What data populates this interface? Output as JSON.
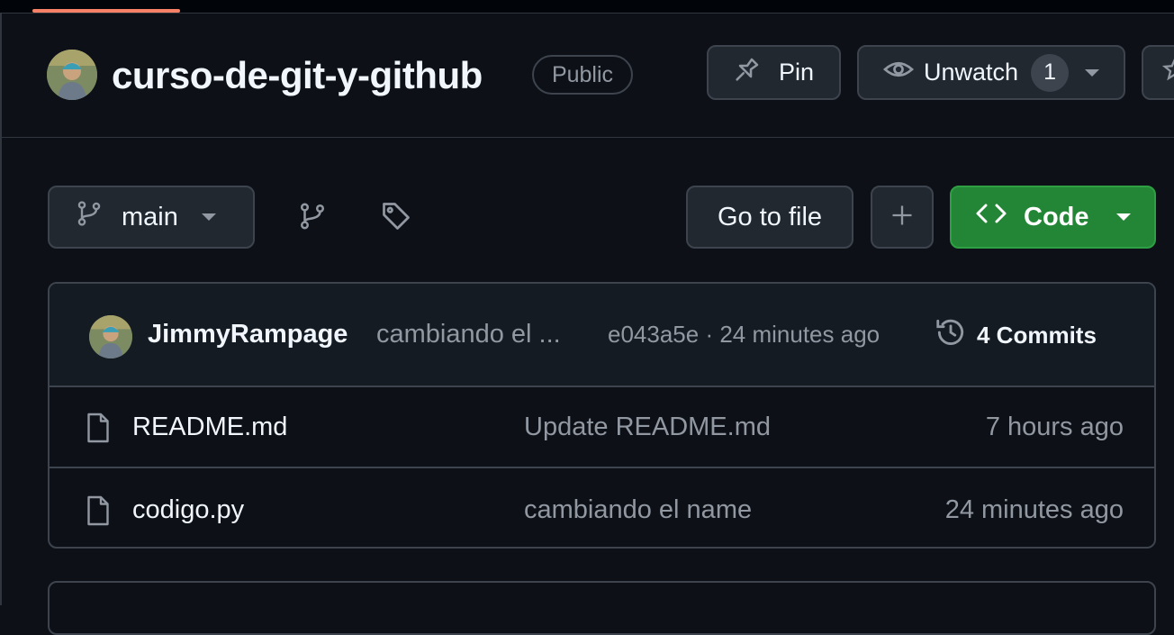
{
  "repo": {
    "name": "curso-de-git-y-github",
    "visibility": "Public"
  },
  "header_actions": {
    "pin_label": "Pin",
    "unwatch_label": "Unwatch",
    "watch_count": "1"
  },
  "toolbar": {
    "branch": "main",
    "goto_file_label": "Go to file",
    "code_label": "Code"
  },
  "latest_commit": {
    "author": "JimmyRampage",
    "message": "cambiando el ...",
    "meta": "e043a5e · 24 minutes ago",
    "commits_label": "4 Commits"
  },
  "files": [
    {
      "name": "README.md",
      "message": "Update README.md",
      "age": "7 hours ago"
    },
    {
      "name": "codigo.py",
      "message": "cambiando el name",
      "age": "24 minutes ago"
    }
  ],
  "icons": {
    "pin": "pin-icon",
    "eye": "eye-icon",
    "branch": "git-branch-icon",
    "tag": "tag-icon",
    "plus": "plus-icon",
    "code": "code-icon",
    "history": "history-icon",
    "file": "file-icon"
  },
  "colors": {
    "background": "#0d1117",
    "code_button": "#238636",
    "tab_underline": "#f78166"
  }
}
